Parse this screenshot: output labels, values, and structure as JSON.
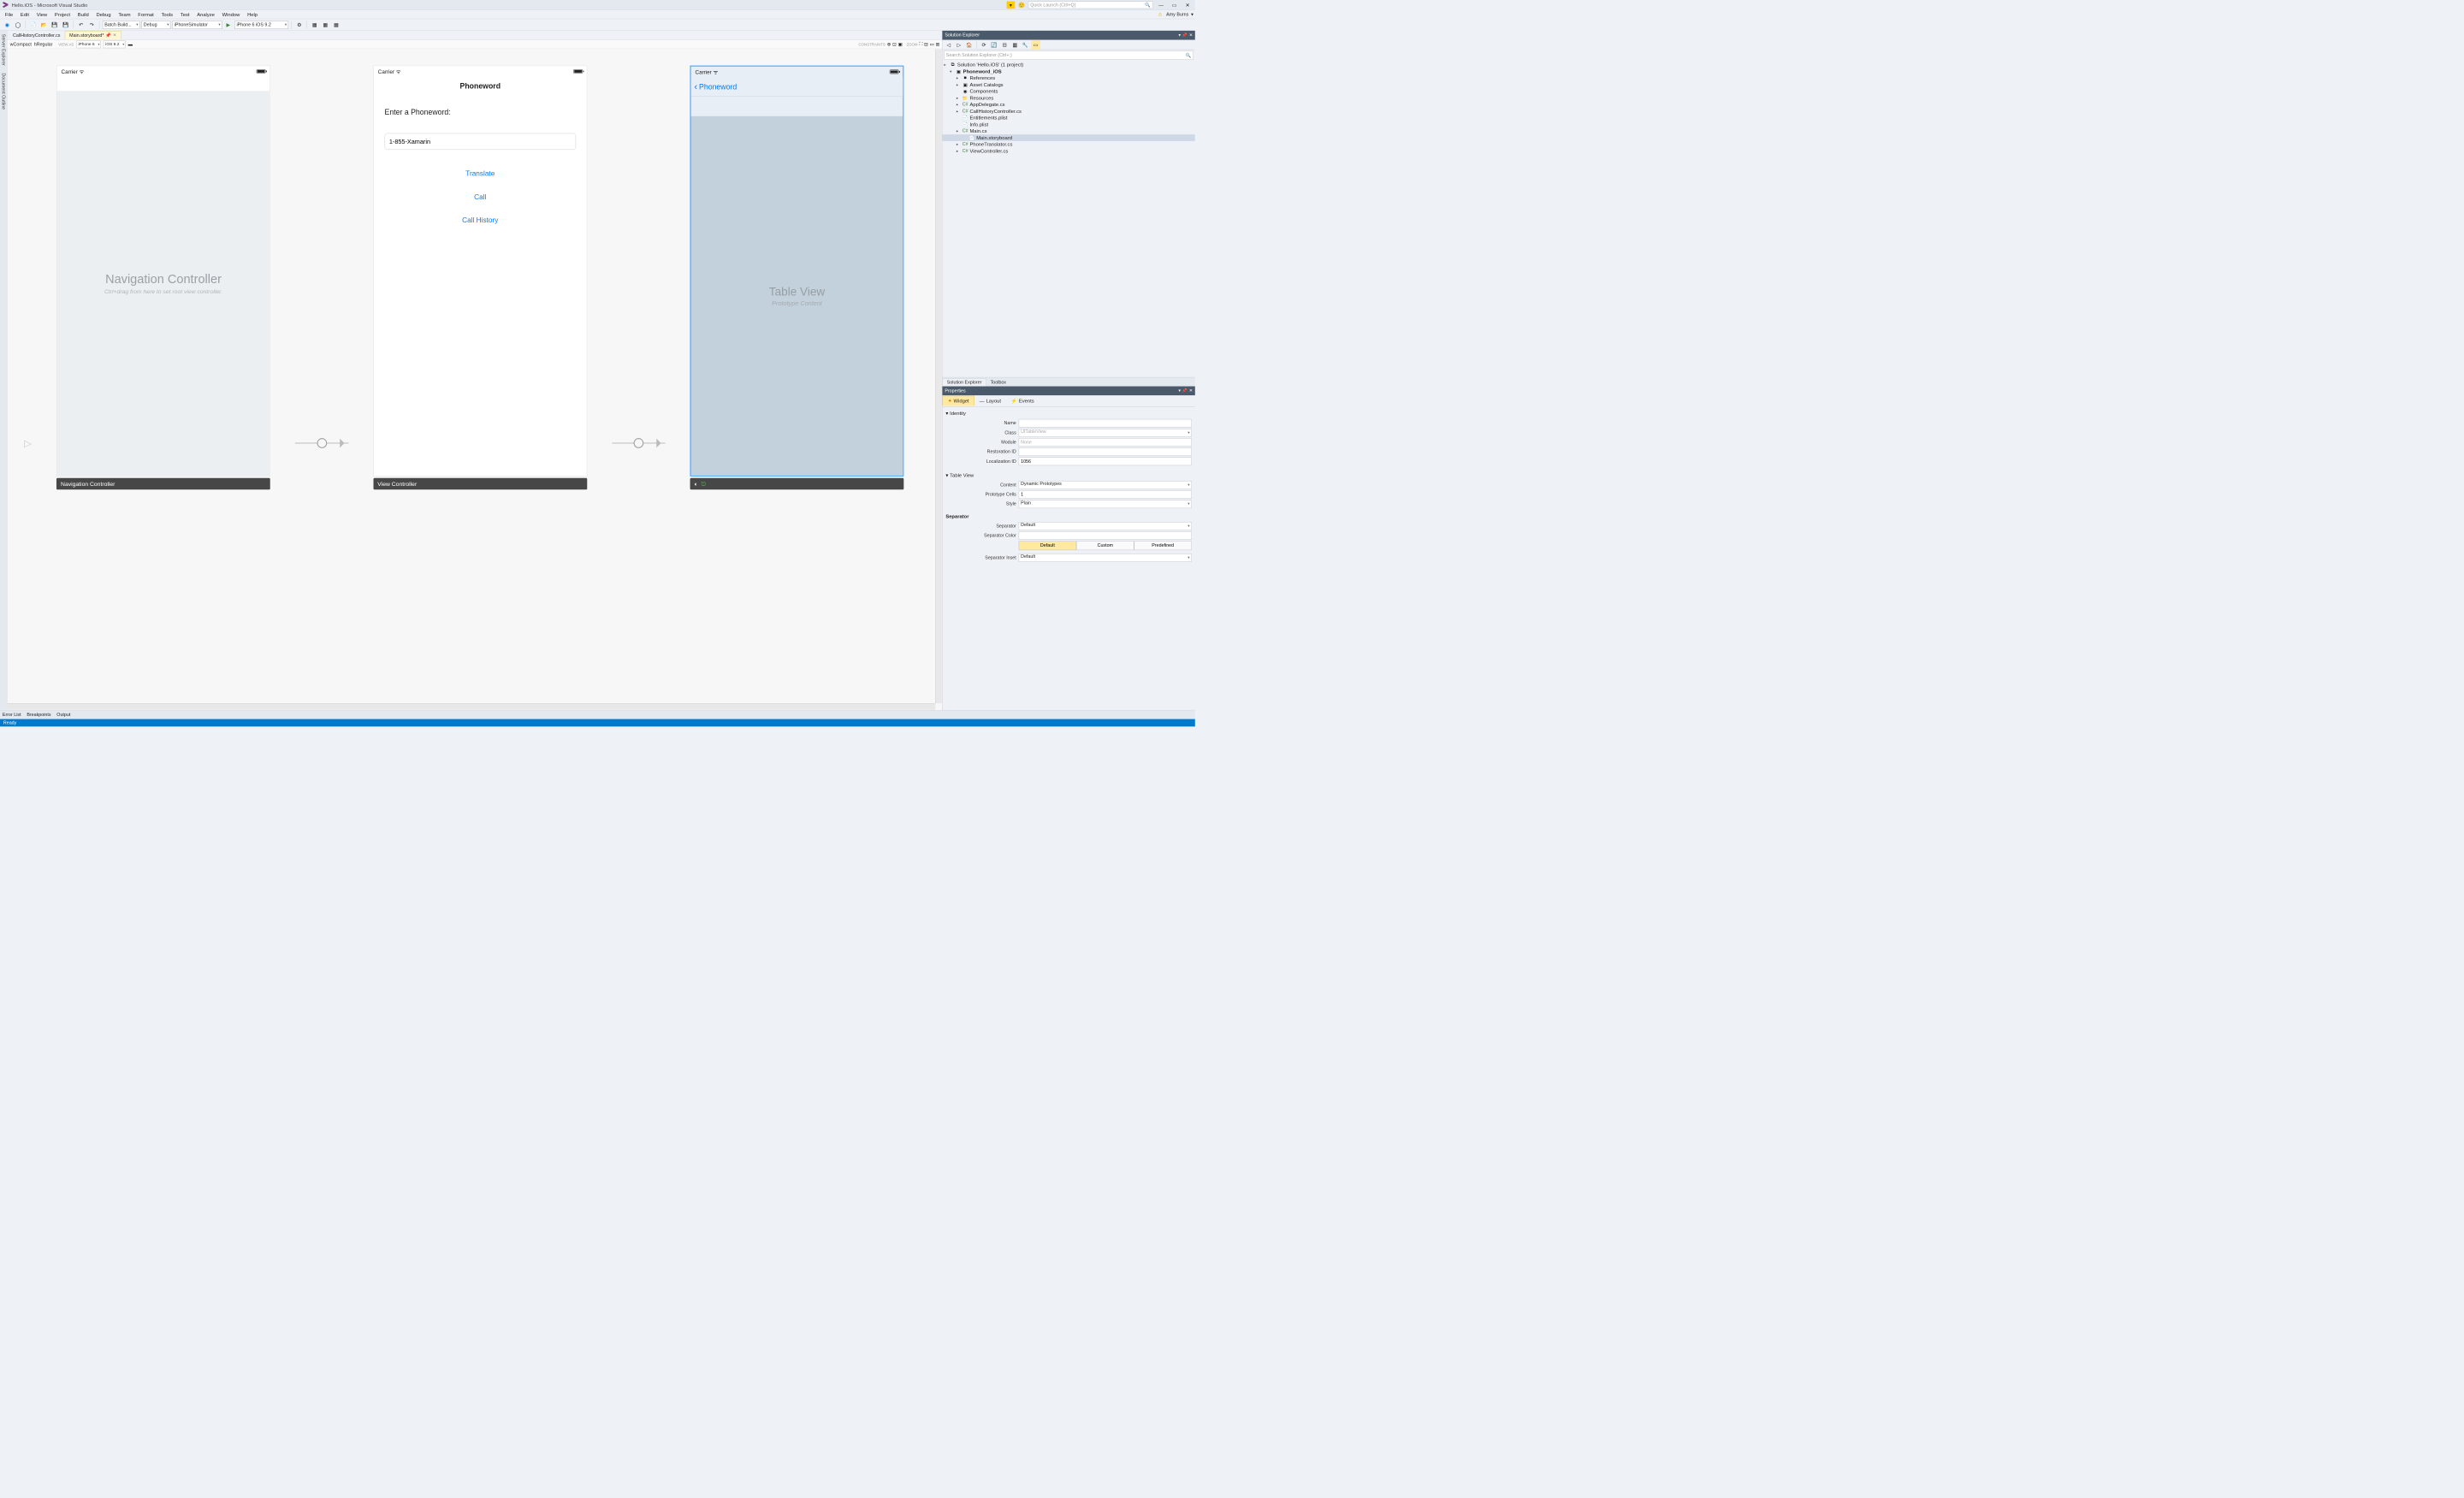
{
  "titlebar": {
    "text": "Hello.iOS - Microsoft Visual Studio",
    "quick_launch": "Quick Launch (Ctrl+Q)"
  },
  "menubar": {
    "items": [
      "File",
      "Edit",
      "View",
      "Project",
      "Build",
      "Debug",
      "Team",
      "Format",
      "Tools",
      "Test",
      "Analyze",
      "Window",
      "Help"
    ],
    "user": "Amy Burns"
  },
  "toolbar": {
    "batch": "Batch Build...",
    "config": "Debug",
    "platform": "iPhoneSimulator",
    "target": "iPhone 6 iOS 9.2"
  },
  "doc_tabs": [
    "CallHistoryController.cs",
    "Main.storyboard*"
  ],
  "sb_toolbar": {
    "size1": "wCompact",
    "size2": "hRegular",
    "viewas": "VIEW AS",
    "device": "iPhone 6",
    "ios": "iOS 9.2",
    "constraints": "CONSTRAINTS",
    "zoom": "ZOOM"
  },
  "scene1": {
    "carrier": "Carrier",
    "title": "Navigation Controller",
    "hint": "Ctrl+drag from here to set root view controller.",
    "label": "Navigation Controller"
  },
  "scene2": {
    "carrier": "Carrier",
    "navtitle": "Phoneword",
    "heading": "Enter a Phoneword:",
    "input": "1-855-Xamarin",
    "btn1": "Translate",
    "btn2": "Call",
    "btn3": "Call History",
    "label": "View Controller"
  },
  "scene3": {
    "carrier": "Carrier",
    "back": "Phoneword",
    "tv": "Table View",
    "tvp": "Prototype Content"
  },
  "solution": {
    "header": "Solution Explorer",
    "search": "Search Solution Explorer (Ctrl+;)",
    "root": "Solution 'Hello.iOS' (1 project)",
    "project": "Phoneword_iOS",
    "items": [
      "References",
      "Asset Catalogs",
      "Components",
      "Resources",
      "AppDelegate.cs",
      "CallHistoryController.cs",
      "Entitlements.plist",
      "Info.plist",
      "Main.cs",
      "Main.storyboard",
      "PhoneTranslator.cs",
      "ViewController.cs"
    ],
    "tabs": [
      "Solution Explorer",
      "Toolbox"
    ]
  },
  "props": {
    "header": "Properties",
    "tabs": [
      "Widget",
      "Layout",
      "Events"
    ],
    "sections": {
      "identity": "Identity",
      "tableview": "Table View",
      "separator": "Separator"
    },
    "labels": {
      "name": "Name",
      "class": "Class",
      "module": "Module",
      "restoration": "Restoration ID",
      "localization": "Localization ID",
      "content": "Content",
      "proto": "Prototype Cells",
      "style": "Style",
      "sep": "Separator",
      "sepcolor": "Separator Color",
      "sepinset": "Separator Inset"
    },
    "values": {
      "class": "UITableView",
      "module": "None",
      "localization": "1056",
      "content": "Dynamic Prototypes",
      "proto": "1",
      "style": "Plain",
      "sep": "Default",
      "sepinset": "Default",
      "seg": [
        "Default",
        "Custom",
        "Predefined"
      ]
    }
  },
  "bottom": {
    "tabs": [
      "Error List",
      "Breakpoints",
      "Output"
    ],
    "status": "Ready"
  }
}
